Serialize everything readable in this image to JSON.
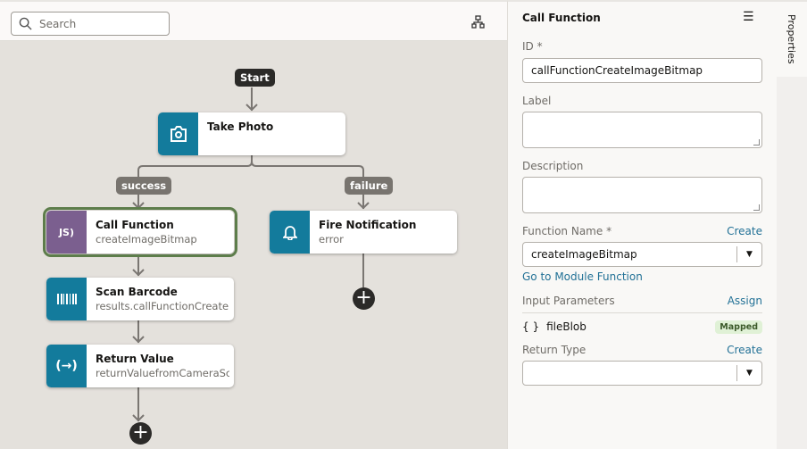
{
  "toolbar": {
    "search_placeholder": "Search",
    "diagram_icon": "hierarchy-icon"
  },
  "flow": {
    "start": "Start",
    "branches": {
      "success": "success",
      "failure": "failure"
    },
    "nodes": [
      {
        "title": "Take Photo",
        "subtitle": "",
        "icon": "camera-icon",
        "color": "#137b9c"
      },
      {
        "title": "Call Function",
        "subtitle": "createImageBitmap",
        "icon": "js-icon",
        "color": "#7b5f8f",
        "selected": true
      },
      {
        "title": "Fire Notification",
        "subtitle": "error",
        "icon": "bell-icon",
        "color": "#137b9c"
      },
      {
        "title": "Scan Barcode",
        "subtitle": "results.callFunctionCreateI",
        "icon": "barcode-icon",
        "color": "#137b9c"
      },
      {
        "title": "Return Value",
        "subtitle": "returnValuefromCameraSc",
        "icon": "return-icon",
        "color": "#137b9c"
      }
    ]
  },
  "panel": {
    "title": "Call Function",
    "id_label": "ID",
    "required": "*",
    "id_value": "callFunctionCreateImageBitmap",
    "label_label": "Label",
    "label_value": "",
    "description_label": "Description",
    "description_value": "",
    "function_name_label": "Function Name",
    "function_name_create": "Create",
    "function_name_value": "createImageBitmap",
    "go_to_module": "Go to Module Function",
    "input_params_label": "Input Parameters",
    "assign": "Assign",
    "params": [
      {
        "brace": "{ }",
        "name": "fileBlob",
        "status": "Mapped"
      }
    ],
    "return_type_label": "Return Type",
    "return_type_create": "Create",
    "return_type_value": ""
  },
  "tabs": {
    "properties": "Properties"
  },
  "colors": {
    "accent": "#227196",
    "selected": "#5d7d4b",
    "mapped_bg": "#e0f1d6"
  }
}
